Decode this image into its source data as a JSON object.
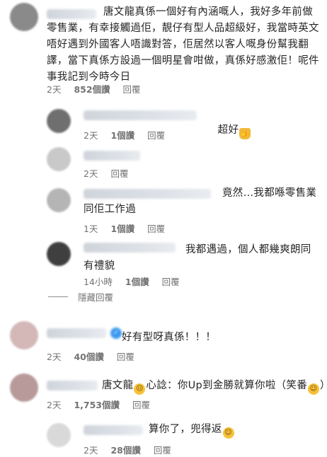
{
  "comments": [
    {
      "text": "唐文龍真係一個好有內涵嘅人，我好多年前做零售業，有幸接觸過佢，靚仔有型人品超級好，我當時英文唔好遇到外國客人唔識對答，佢居然以客人嘅身份幫我翻譯，當下真係方設過一個明星會咁做，真係好感激佢！呢件事我記到今時今日",
      "time": "2天",
      "likes": "852個讚",
      "reply": "回覆"
    },
    {
      "text": "超好",
      "time": "2天",
      "likes": "1個讚",
      "reply": "回覆"
    },
    {
      "time": "2天",
      "reply": "回覆"
    },
    {
      "text": "竟然…我都喺零售業同佢工作過",
      "time": "1天",
      "likes": "1個讚",
      "reply": "回覆"
    },
    {
      "text": "我都遇過，個人都幾爽朗同有禮貌",
      "time": "14小時",
      "likes": "1個讚",
      "reply": "回覆"
    },
    {
      "text": "好有型呀真係！！！",
      "time": "2天",
      "likes": "40個讚",
      "reply": "回覆"
    },
    {
      "text": "唐文龍",
      "text2": "心諗：你Up到金勝就算你啦（笑番",
      "text3": "）",
      "time": "2天",
      "likes": "1,753個讚",
      "reply": "回覆"
    },
    {
      "text": "算你了，兜得返",
      "time": "2天",
      "likes": "28個讚",
      "reply": "回覆"
    }
  ],
  "hide_replies": "隱藏回覆",
  "colors": {
    "text": "#262626",
    "meta": "#737373",
    "verified": "#3897f0"
  }
}
